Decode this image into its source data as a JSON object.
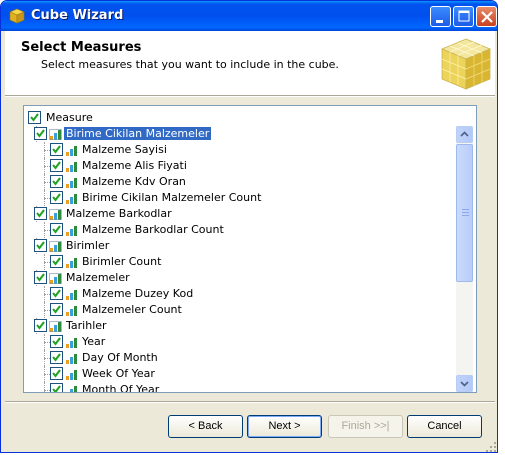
{
  "window": {
    "title": "Cube Wizard",
    "icon": "cube-icon"
  },
  "header": {
    "title": "Select Measures",
    "subtitle": "Select measures that you want to include in the cube."
  },
  "tree": {
    "root_label": "Measure",
    "rows": [
      {
        "label": "Birime Cikilan Malzemeler",
        "level": 0,
        "checked": true,
        "selected": true
      },
      {
        "label": "Malzeme Sayisi",
        "level": 1,
        "checked": true
      },
      {
        "label": "Malzeme Alis Fiyati",
        "level": 1,
        "checked": true
      },
      {
        "label": "Malzeme Kdv Oran",
        "level": 1,
        "checked": true
      },
      {
        "label": "Birime Cikilan Malzemeler Count",
        "level": 1,
        "checked": true
      },
      {
        "label": "Malzeme Barkodlar",
        "level": 0,
        "checked": true
      },
      {
        "label": "Malzeme Barkodlar Count",
        "level": 1,
        "checked": true
      },
      {
        "label": "Birimler",
        "level": 0,
        "checked": true
      },
      {
        "label": "Birimler Count",
        "level": 1,
        "checked": true
      },
      {
        "label": "Malzemeler",
        "level": 0,
        "checked": true
      },
      {
        "label": "Malzeme Duzey Kod",
        "level": 1,
        "checked": true
      },
      {
        "label": "Malzemeler Count",
        "level": 1,
        "checked": true
      },
      {
        "label": "Tarihler",
        "level": 0,
        "checked": true
      },
      {
        "label": "Year",
        "level": 1,
        "checked": true
      },
      {
        "label": "Day Of Month",
        "level": 1,
        "checked": true
      },
      {
        "label": "Week Of Year",
        "level": 1,
        "checked": true
      },
      {
        "label": "Month Of Year",
        "level": 1,
        "checked": true
      }
    ]
  },
  "buttons": {
    "back": "< Back",
    "next": "Next >",
    "finish": "Finish >>|",
    "cancel": "Cancel"
  },
  "colors": {
    "selection": "#316ac5",
    "titlebar": "#0053ee",
    "bar_icon": [
      "#e8a020",
      "#3aa0d8",
      "#2e8b3a"
    ]
  }
}
